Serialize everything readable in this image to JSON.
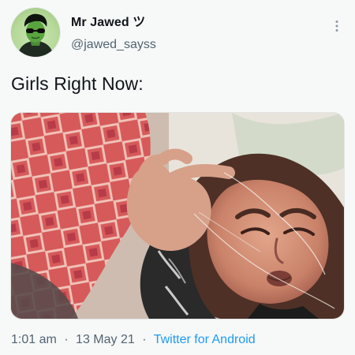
{
  "tweet": {
    "author": {
      "display_name": "Mr Jawed ツ",
      "handle": "@jawed_sayss"
    },
    "text": "Girls Right Now:",
    "more_icon": "vertical-ellipsis-icon",
    "meta": {
      "time": "1:01 am",
      "separator": "·",
      "date": "13 May 21",
      "source": "Twitter for Android"
    },
    "colors": {
      "background": "#f7f9f9",
      "text": "#0f1419",
      "secondary": "#536471",
      "link": "#1d9bf0"
    }
  }
}
